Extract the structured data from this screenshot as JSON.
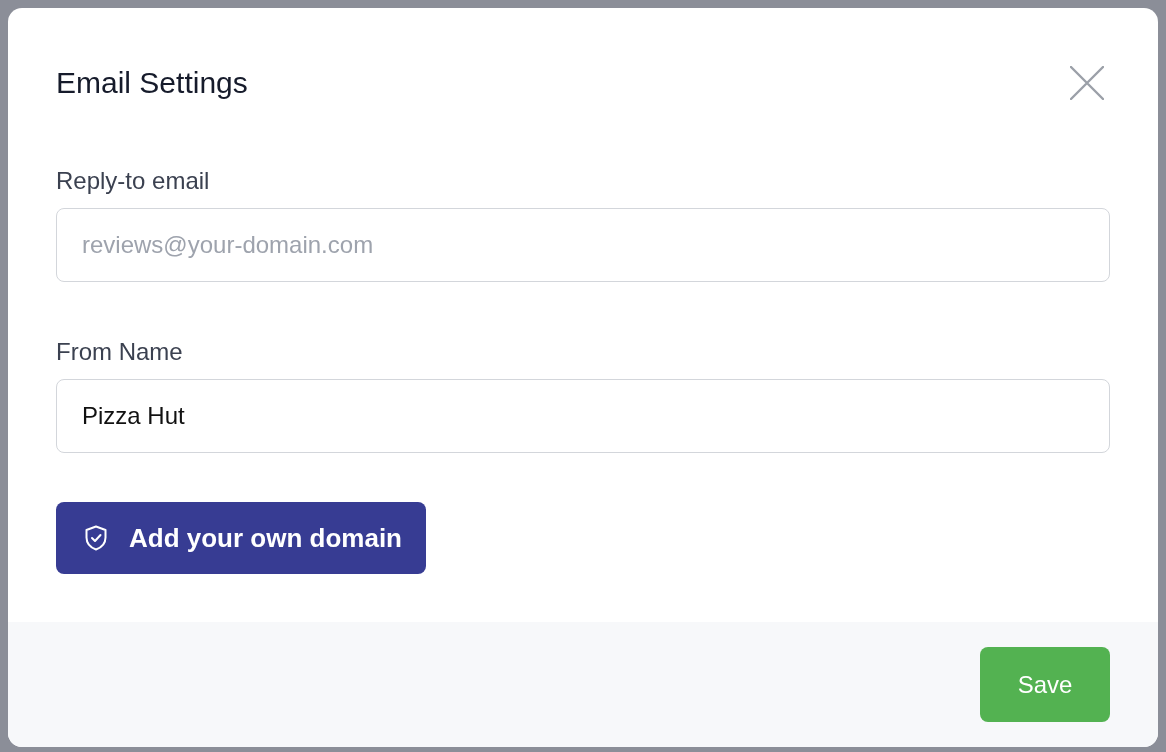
{
  "modal": {
    "title": "Email Settings",
    "fields": [
      {
        "label": "Reply-to email",
        "placeholder": "reviews@your-domain.com"
      },
      {
        "label": "From Name",
        "value": "Pizza Hut"
      }
    ],
    "domain_button": {
      "label": "Add your own domain"
    },
    "footer_buttons": [
      {
        "label": "Save",
        "kind": "primary"
      }
    ]
  }
}
